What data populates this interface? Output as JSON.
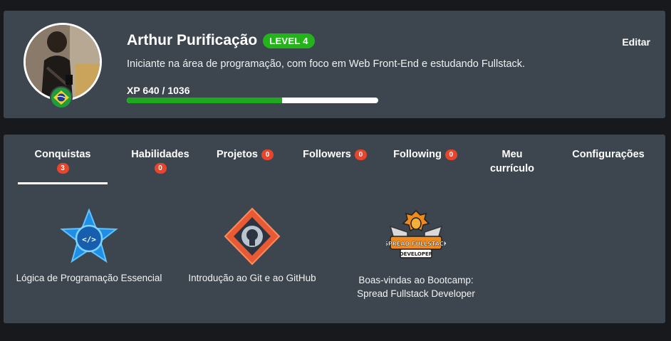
{
  "profile": {
    "name": "Arthur Purificação",
    "level": "LEVEL 4",
    "bio": "Iniciante na área de programação, com foco em Web Front-End e estudando Fullstack.",
    "xp_text": "XP 640 / 1036",
    "xp_current": 640,
    "xp_total": 1036,
    "edit_label": "Editar",
    "flag_icon": "brazil-flag-icon"
  },
  "tabs": [
    {
      "label": "Conquistas",
      "count": "3"
    },
    {
      "label": "Habilidades",
      "count": "0"
    },
    {
      "label": "Projetos",
      "count": "0"
    },
    {
      "label": "Followers",
      "count": "0"
    },
    {
      "label": "Following",
      "count": "0"
    },
    {
      "label": "Meu currículo"
    },
    {
      "label": "Configurações"
    }
  ],
  "achievements": [
    {
      "title": "Lógica de Programação Essencial",
      "icon": "code-star-badge-icon"
    },
    {
      "title_line1": "Introdução ao Git e ao GitHub",
      "icon": "git-github-badge-icon"
    },
    {
      "title_line1": "Boas-vindas ao Bootcamp:",
      "title_line2": "Spread Fullstack Developer",
      "icon": "spread-fullstack-badge-icon",
      "badge_text_1": "SPREAD FULLSTACK",
      "badge_text_2": "DEVELOPER"
    }
  ],
  "colors": {
    "background": "#17191c",
    "card": "#3d464f",
    "level_badge": "#25b31b",
    "xp_fill": "#1ea81e",
    "count_badge": "#e8452c"
  }
}
